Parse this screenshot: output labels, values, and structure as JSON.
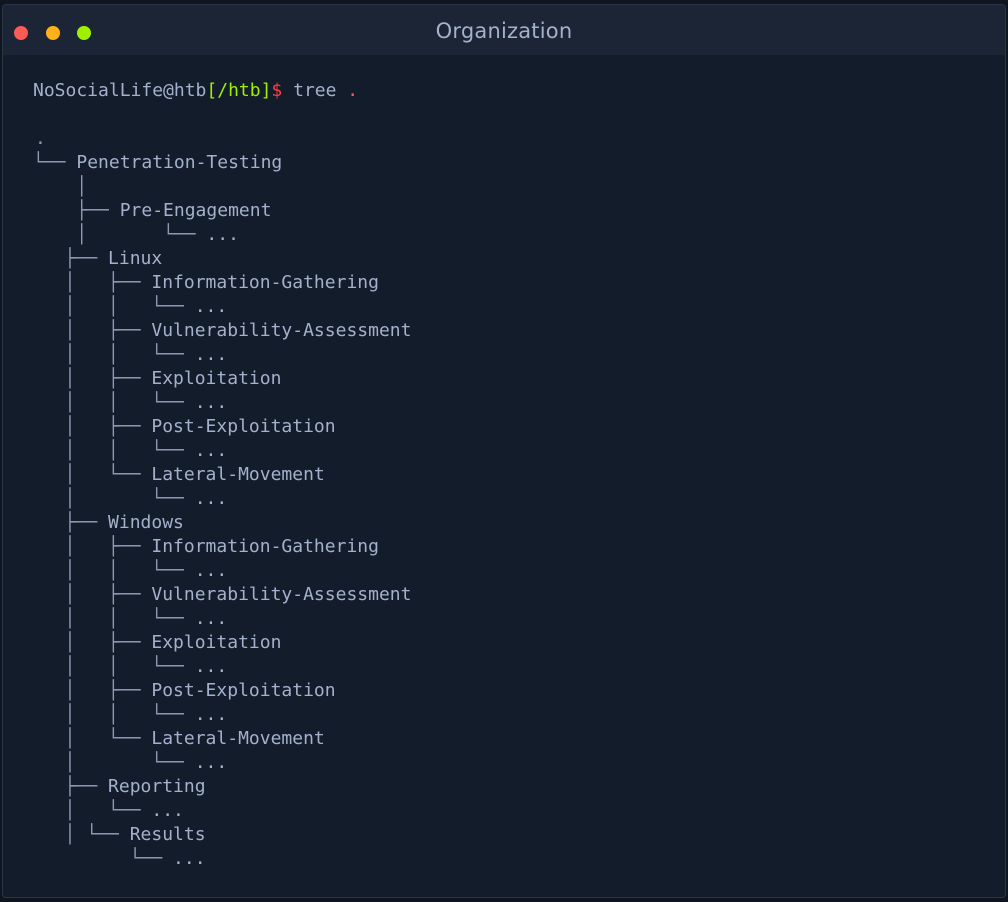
{
  "window": {
    "title": "Organization",
    "colors": {
      "close": "#fb5a55",
      "minimize": "#ffb11a",
      "maximize": "#9fef00",
      "background": "#131c2a",
      "text": "#a4b1cd",
      "dir_accent": "#9fef00",
      "prompt_symbol": "#ff3e3e"
    }
  },
  "terminal": {
    "prompt": {
      "user_host": "NoSocialLife@htb",
      "dir": "[/htb]",
      "symbol": "$",
      "command": " tree",
      "arg": " ."
    },
    "tree_lines": [
      {
        "prefix": ".",
        "name": ""
      },
      {
        "prefix": "└── ",
        "name": "Penetration-Testing"
      },
      {
        "prefix": "    │",
        "name": ""
      },
      {
        "prefix": "    ├── ",
        "name": "Pre-Engagement"
      },
      {
        "prefix": "    │       └── ",
        "name": "..."
      },
      {
        "prefix": "  ├── ",
        "name": "Linux"
      },
      {
        "prefix": "  │   ├── ",
        "name": "Information-Gathering"
      },
      {
        "prefix": "  │   │   └── ",
        "name": "..."
      },
      {
        "prefix": "  │   ├── ",
        "name": "Vulnerability-Assessment"
      },
      {
        "prefix": "  │   │   └── ",
        "name": "..."
      },
      {
        "prefix": "  │   ├── ",
        "name": "Exploitation"
      },
      {
        "prefix": "  │   │   └── ",
        "name": "..."
      },
      {
        "prefix": "  │   ├── ",
        "name": "Post-Exploitation"
      },
      {
        "prefix": "  │   │   └── ",
        "name": "..."
      },
      {
        "prefix": "  │   └── ",
        "name": "Lateral-Movement"
      },
      {
        "prefix": "  │       └── ",
        "name": "..."
      },
      {
        "prefix": "  ├── ",
        "name": "Windows"
      },
      {
        "prefix": "  │   ├── ",
        "name": "Information-Gathering"
      },
      {
        "prefix": "  │   │   └── ",
        "name": "..."
      },
      {
        "prefix": "  │   ├── ",
        "name": "Vulnerability-Assessment"
      },
      {
        "prefix": "  │   │   └── ",
        "name": "..."
      },
      {
        "prefix": "  │   ├── ",
        "name": "Exploitation"
      },
      {
        "prefix": "  │   │   └── ",
        "name": "..."
      },
      {
        "prefix": "  │   ├── ",
        "name": "Post-Exploitation"
      },
      {
        "prefix": "  │   │   └── ",
        "name": "..."
      },
      {
        "prefix": "  │   └── ",
        "name": "Lateral-Movement"
      },
      {
        "prefix": "  │       └── ",
        "name": "..."
      },
      {
        "prefix": "  ├── ",
        "name": "Reporting"
      },
      {
        "prefix": "  │   └── ",
        "name": "..."
      },
      {
        "prefix": "  │ └── ",
        "name": "Results"
      },
      {
        "prefix": "        └── ",
        "name": "..."
      }
    ]
  }
}
